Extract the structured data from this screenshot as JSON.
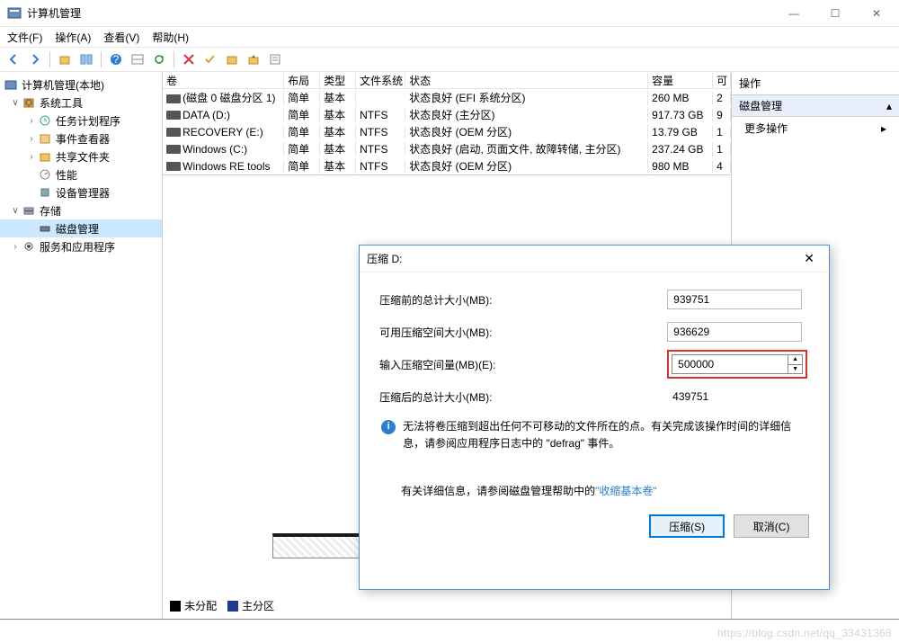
{
  "window": {
    "title": "计算机管理"
  },
  "menu": {
    "file": "文件(F)",
    "action": "操作(A)",
    "view": "查看(V)",
    "help": "帮助(H)"
  },
  "tree": {
    "root": "计算机管理(本地)",
    "systools": "系统工具",
    "scheduler": "任务计划程序",
    "eventviewer": "事件查看器",
    "sharedfolders": "共享文件夹",
    "performance": "性能",
    "devicemgr": "设备管理器",
    "storage": "存储",
    "diskmgmt": "磁盘管理",
    "services": "服务和应用程序"
  },
  "columns": {
    "vol": "卷",
    "layout": "布局",
    "type": "类型",
    "fs": "文件系统",
    "status": "状态",
    "capacity": "容量",
    "free": "可"
  },
  "volumes": [
    {
      "name": "(磁盘 0 磁盘分区 1)",
      "layout": "简单",
      "type": "基本",
      "fs": "",
      "status": "状态良好 (EFI 系统分区)",
      "capacity": "260 MB",
      "free": "2"
    },
    {
      "name": "DATA (D:)",
      "layout": "简单",
      "type": "基本",
      "fs": "NTFS",
      "status": "状态良好 (主分区)",
      "capacity": "917.73 GB",
      "free": "9"
    },
    {
      "name": "RECOVERY (E:)",
      "layout": "简单",
      "type": "基本",
      "fs": "NTFS",
      "status": "状态良好 (OEM 分区)",
      "capacity": "13.79 GB",
      "free": "1"
    },
    {
      "name": "Windows (C:)",
      "layout": "简单",
      "type": "基本",
      "fs": "NTFS",
      "status": "状态良好 (启动, 页面文件, 故障转储, 主分区)",
      "capacity": "237.24 GB",
      "free": "1"
    },
    {
      "name": "Windows RE tools",
      "layout": "简单",
      "type": "基本",
      "fs": "NTFS",
      "status": "状态良好 (OEM 分区)",
      "capacity": "980 MB",
      "free": "4"
    }
  ],
  "actions": {
    "header": "操作",
    "section": "磁盘管理",
    "more": "更多操作"
  },
  "dialog": {
    "title": "压缩 D:",
    "total_label": "压缩前的总计大小(MB):",
    "total_value": "939751",
    "avail_label": "可用压缩空间大小(MB):",
    "avail_value": "936629",
    "input_label": "输入压缩空间量(MB)(E):",
    "input_value": "500000",
    "after_label": "压缩后的总计大小(MB):",
    "after_value": "439751",
    "info1": "无法将卷压缩到超出任何不可移动的文件所在的点。有关完成该操作时间的详细信息，请参阅应用程序日志中的 \"defrag\" 事件。",
    "info2_a": "有关详细信息，请参阅磁盘管理帮助中的",
    "info2_b": "\"收缩基本卷\"",
    "shrink": "压缩(S)",
    "cancel": "取消(C)"
  },
  "legend": {
    "unalloc": "未分配",
    "primary": "主分区"
  },
  "watermark": "https://blog.csdn.net/qq_33431368"
}
